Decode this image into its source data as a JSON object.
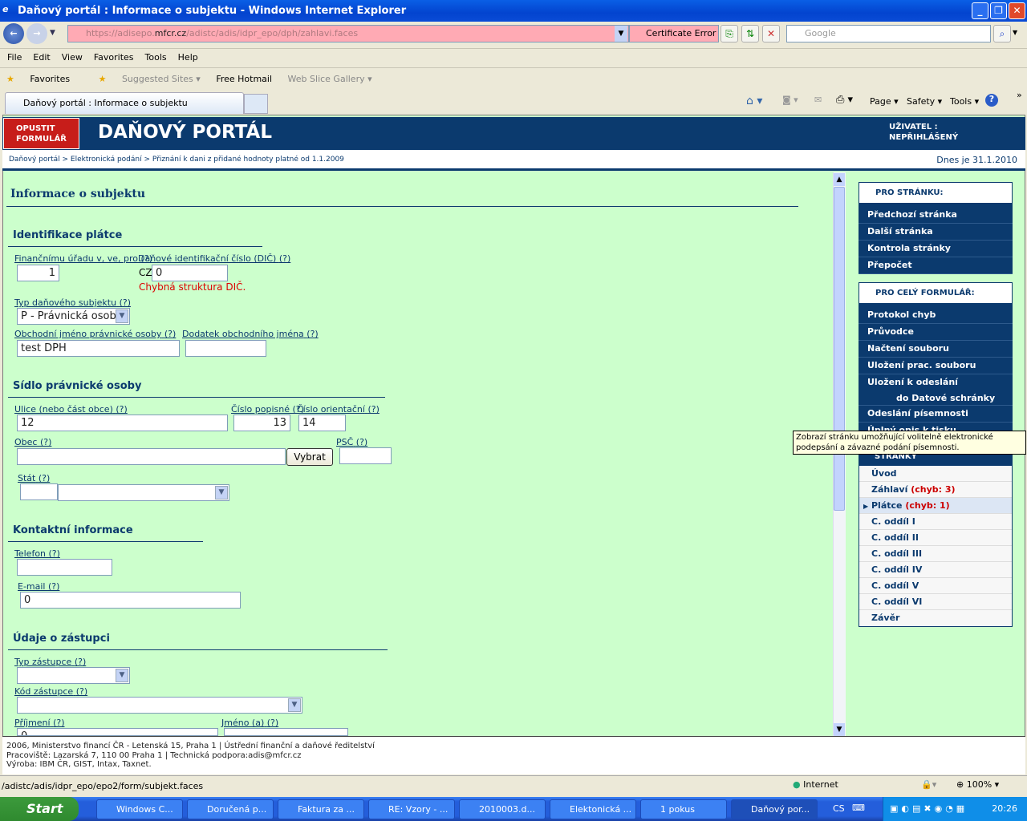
{
  "window": {
    "title": "Daňový portál :  Informace o subjektu - Windows Internet Explorer"
  },
  "address": {
    "url_pre": "https://adisepo.",
    "url_host": "mfcr.cz",
    "url_post": "/adistc/adis/idpr_epo/dph/zahlavi.faces",
    "cert": "Certificate Error",
    "search_placeholder": "Google"
  },
  "menu": [
    "File",
    "Edit",
    "View",
    "Favorites",
    "Tools",
    "Help"
  ],
  "favorites": {
    "label": "Favorites",
    "items": [
      "Suggested Sites ▾",
      "Free Hotmail",
      "Web Slice Gallery ▾"
    ]
  },
  "tab": {
    "label": "Daňový portál :  Informace o subjektu"
  },
  "cmdbar": {
    "page": "Page ▾",
    "safety": "Safety ▾",
    "tools": "Tools ▾"
  },
  "header": {
    "quit": "OPUSTIT FORMULÁŘ",
    "brand": "DAŇOVÝ PORTÁL",
    "user_label": "UŽIVATEL :",
    "user_value": "NEPŘIHLÁŠENÝ"
  },
  "breadcrumb": "Daňový portál > Elektronická podání > Přiznání k dani z přidané hodnoty platné od 1.1.2009",
  "today": "Dnes je 31.1.2010",
  "form": {
    "title": "Informace o subjektu",
    "sections": {
      "ident": "Identifikace plátce",
      "sidlo": "Sídlo právnické osoby",
      "kontakt": "Kontaktní informace",
      "zastupce": "Údaje o zástupci"
    },
    "help": "(?)",
    "fields": {
      "fu": {
        "label": "Finančnímu úřadu v, ve, pro",
        "value": "1"
      },
      "dic": {
        "label": "Daňové identifikační číslo (DIČ) ",
        "prefix": "CZ",
        "value": "0",
        "error": "Chybná struktura DIČ."
      },
      "typ": {
        "label": "Typ daňového subjektu",
        "value": "P - Právnická osoba"
      },
      "obch": {
        "label": "Obchodní jméno právnické osoby",
        "value": "test DPH"
      },
      "dodatek": {
        "label": "Dodatek obchodního jména",
        "value": ""
      },
      "ulice": {
        "label": "Ulice (nebo část obce)",
        "value": "12"
      },
      "cp": {
        "label": "Číslo popisné",
        "value": "13"
      },
      "co": {
        "label": "Číslo orientační",
        "value": "14"
      },
      "obec": {
        "label": "Obec",
        "value": "",
        "button": "Vybrat"
      },
      "psc": {
        "label": "PSČ",
        "value": ""
      },
      "stat": {
        "label": "Stát",
        "value": ""
      },
      "tel": {
        "label": "Telefon",
        "value": ""
      },
      "email": {
        "label": "E-mail ",
        "value": "0"
      },
      "typz": {
        "label": "Typ zástupce",
        "value": ""
      },
      "kodz": {
        "label": "Kód zástupce",
        "value": ""
      },
      "prijmeni": {
        "label": "Příjmení",
        "value": "0"
      },
      "jmeno": {
        "label": "Jméno (a)",
        "value": ""
      }
    }
  },
  "panel": {
    "page_head": "PRO STRÁNKU:",
    "page_items": [
      "Předchozí stránka",
      "Další stránka",
      "Kontrola stránky",
      "Přepočet"
    ],
    "form_head": "PRO CELÝ FORMULÁŘ:",
    "form_items": [
      "Protokol chyb",
      "Průvodce",
      "Načtení souboru",
      "Uložení prac. souboru",
      "Uložení k odeslání",
      "do Datové schránky",
      "Odeslání písemnosti",
      "Úplný opis k tisku"
    ],
    "pages_head": "STRÁNKY",
    "pages": [
      {
        "label": "Úvod"
      },
      {
        "label": "Záhlaví",
        "err": "(chyb: 3)"
      },
      {
        "label": "Plátce",
        "err": "(chyb: 1)"
      },
      {
        "label": "C. oddíl I"
      },
      {
        "label": "C. oddíl II"
      },
      {
        "label": "C. oddíl III"
      },
      {
        "label": "C. oddíl IV"
      },
      {
        "label": "C. oddíl V"
      },
      {
        "label": "C. oddíl VI"
      },
      {
        "label": "Závěr"
      }
    ]
  },
  "tooltip": "Zobrazí stránku umožňující volitelně elektronické podepsání a závazné podání písemnosti.",
  "footer": [
    "2006, Ministerstvo financí ČR - Letenská 15, Praha 1 | Ústřední finanční a daňové ředitelství",
    "Pracoviště: Lazarská 7, 110 00 Praha 1 | Technická podpora:adis@mfcr.cz",
    "Výroba: IBM ČR, GIST, Intax, Taxnet."
  ],
  "status": {
    "url": "/adistc/adis/idpr_epo/epo2/form/subjekt.faces",
    "zone": "Internet",
    "zoom": "100%"
  },
  "taskbar": {
    "start": "Start",
    "tasks": [
      "Windows C...",
      "Doručená p...",
      "Faktura za ...",
      "RE: Vzory - ...",
      "2010003.d...",
      "Elektonická ...",
      "1 pokus",
      "Daňový por..."
    ],
    "lang": "CS",
    "clock": "20:26"
  }
}
